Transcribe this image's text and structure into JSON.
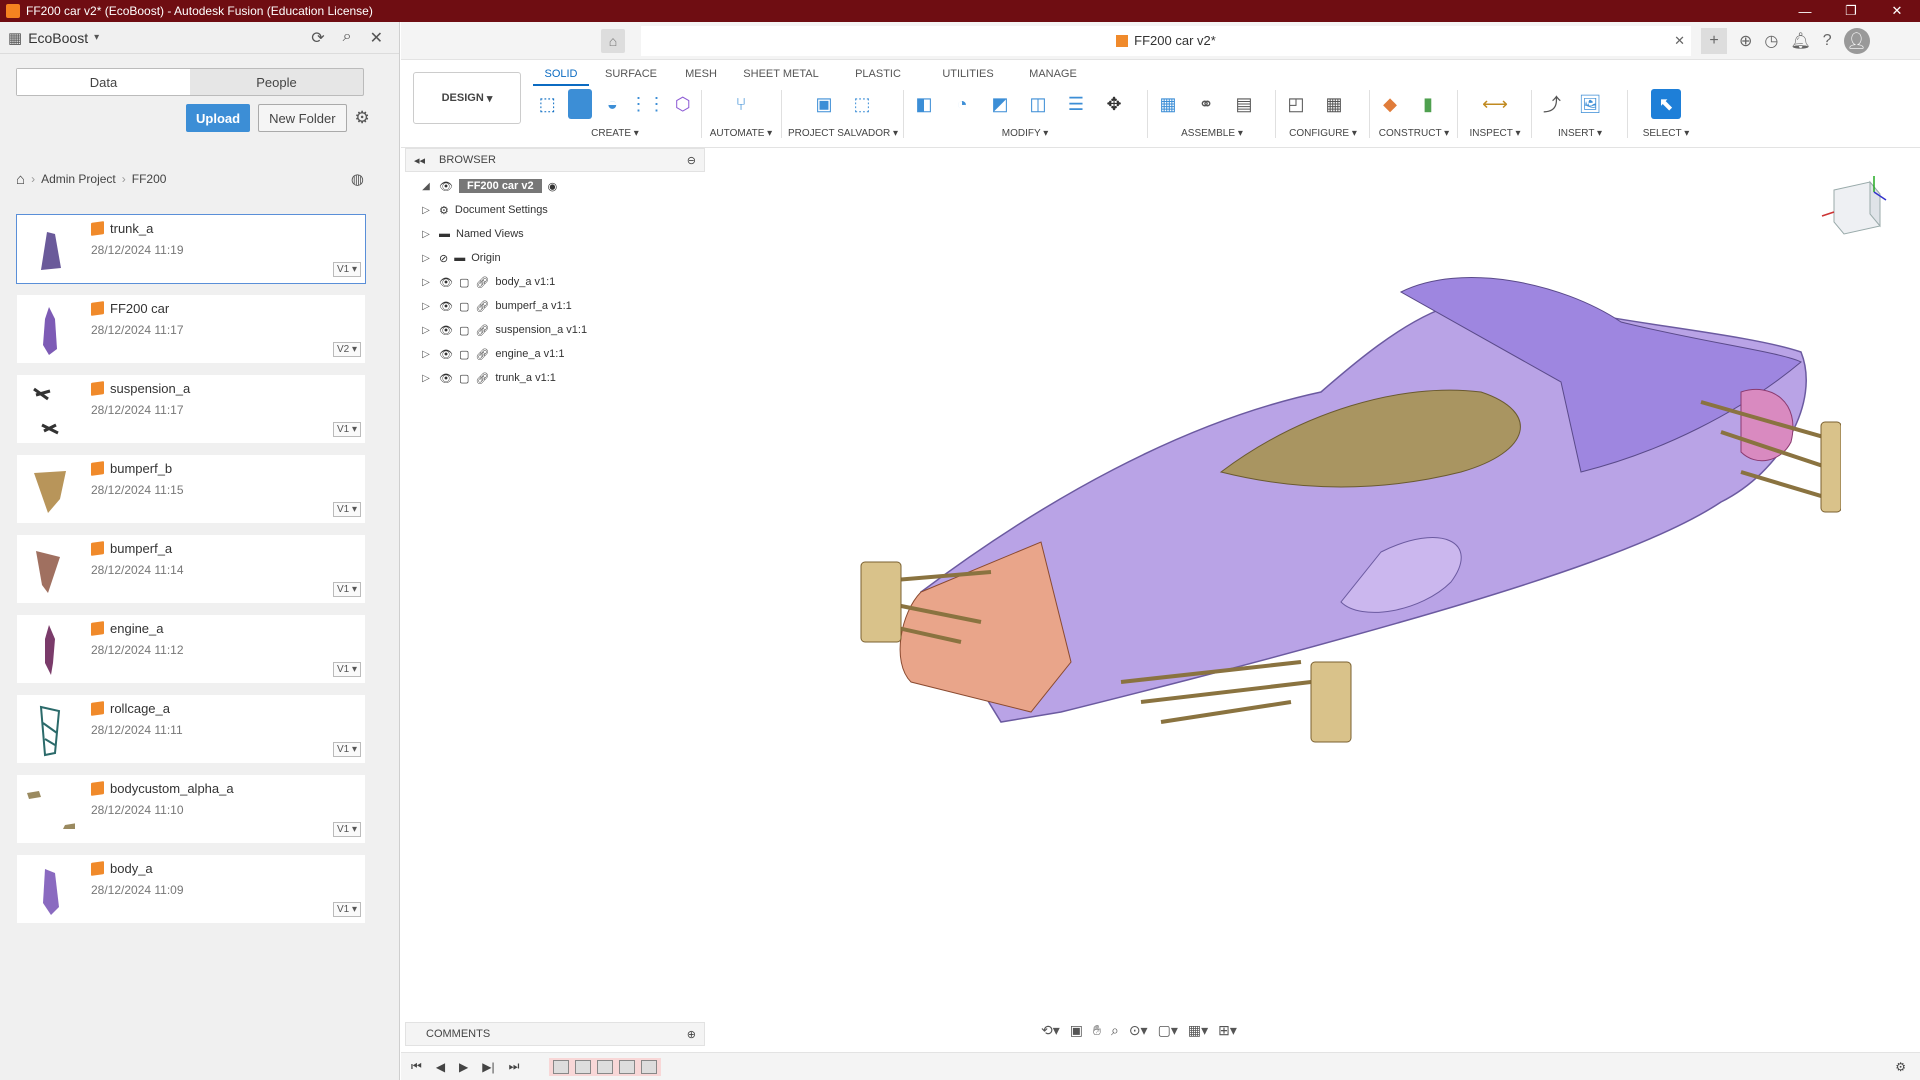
{
  "window": {
    "title": "FF200 car v2* (EcoBoost) - Autodesk Fusion (Education License)",
    "controls": [
      "—",
      "❐",
      "✕"
    ]
  },
  "left_panel": {
    "project": "EcoBoost",
    "tabs": [
      "Data",
      "People"
    ],
    "upload_label": "Upload",
    "new_folder_label": "New Folder",
    "breadcrumb": [
      "Admin Project",
      "FF200"
    ],
    "files": [
      {
        "name": "trunk_a",
        "date": "28/12/2024 11:19",
        "version": "V1",
        "color": "#6a5a9a"
      },
      {
        "name": "FF200 car",
        "date": "28/12/2024 11:17",
        "version": "V2",
        "color": "#7d5bb5"
      },
      {
        "name": "suspension_a",
        "date": "28/12/2024 11:17",
        "version": "V1",
        "color": "#333333"
      },
      {
        "name": "bumperf_b",
        "date": "28/12/2024 11:15",
        "version": "V1",
        "color": "#b8955a"
      },
      {
        "name": "bumperf_a",
        "date": "28/12/2024 11:14",
        "version": "V1",
        "color": "#a07060"
      },
      {
        "name": "engine_a",
        "date": "28/12/2024 11:12",
        "version": "V1",
        "color": "#7a3b6a"
      },
      {
        "name": "rollcage_a",
        "date": "28/12/2024 11:11",
        "version": "V1",
        "color": "#2b6a6a"
      },
      {
        "name": "bodycustom_alpha_a",
        "date": "28/12/2024 11:10",
        "version": "V1",
        "color": "#9a8a60"
      },
      {
        "name": "body_a",
        "date": "28/12/2024 11:09",
        "version": "V1",
        "color": "#8a6ac0"
      }
    ]
  },
  "document": {
    "tab_title": "FF200 car v2*"
  },
  "toolbar": {
    "workspace": "DESIGN",
    "tabs": [
      "SOLID",
      "SURFACE",
      "MESH",
      "SHEET METAL",
      "PLASTIC",
      "UTILITIES",
      "MANAGE"
    ],
    "active_tab": "SOLID",
    "groups": [
      "CREATE",
      "AUTOMATE",
      "PROJECT SALVADOR",
      "MODIFY",
      "ASSEMBLE",
      "CONFIGURE",
      "CONSTRUCT",
      "INSPECT",
      "INSERT",
      "SELECT"
    ]
  },
  "browser": {
    "title": "BROWSER",
    "root": "FF200 car v2",
    "items": [
      "Document Settings",
      "Named Views",
      "Origin",
      "body_a v1:1",
      "bumperf_a v1:1",
      "suspension_a v1:1",
      "engine_a v1:1",
      "trunk_a v1:1"
    ]
  },
  "comments": {
    "title": "COMMENTS"
  },
  "colors": {
    "titlebar": "#6f0d12",
    "accent": "#0b6bc2",
    "upload": "#3c8ed6",
    "body_purple": "#b9a3e6",
    "nose": "#e9a58a",
    "suspension": "#c9b27a"
  }
}
